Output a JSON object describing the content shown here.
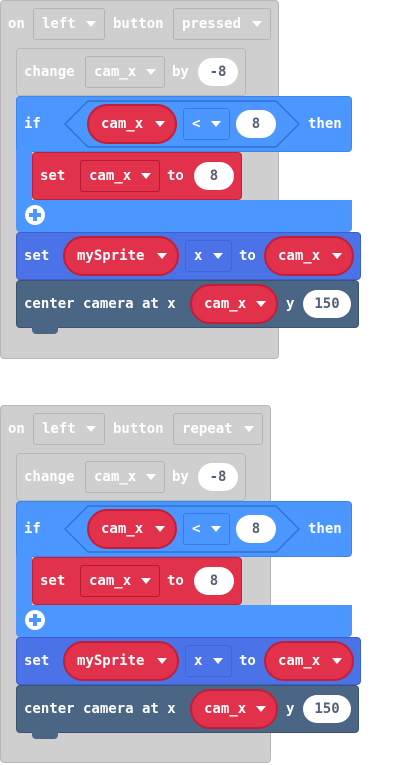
{
  "scripts": [
    {
      "hat": {
        "on": "on",
        "button_key": "left",
        "button": "button",
        "event": "pressed"
      },
      "change": {
        "label": "change",
        "variable": "cam_x",
        "by": "by",
        "amount": "-8"
      },
      "if_block": {
        "if": "if",
        "left": "cam_x",
        "operator": "<",
        "right": "8",
        "then": "then"
      },
      "set_inner": {
        "label": "set",
        "variable": "cam_x",
        "to": "to",
        "value": "8"
      },
      "set_sprite": {
        "label": "set",
        "sprite": "mySprite",
        "property": "x",
        "to": "to",
        "value": "cam_x"
      },
      "camera": {
        "label": "center camera at x",
        "x_value": "cam_x",
        "y": "y",
        "y_value": "150"
      }
    },
    {
      "hat": {
        "on": "on",
        "button_key": "left",
        "button": "button",
        "event": "repeat"
      },
      "change": {
        "label": "change",
        "variable": "cam_x",
        "by": "by",
        "amount": "-8"
      },
      "if_block": {
        "if": "if",
        "left": "cam_x",
        "operator": "<",
        "right": "8",
        "then": "then"
      },
      "set_inner": {
        "label": "set",
        "variable": "cam_x",
        "to": "to",
        "value": "8"
      },
      "set_sprite": {
        "label": "set",
        "sprite": "mySprite",
        "property": "x",
        "to": "to",
        "value": "cam_x"
      },
      "camera": {
        "label": "center camera at x",
        "x_value": "cam_x",
        "y": "y",
        "y_value": "150"
      }
    }
  ],
  "colors": {
    "hat_gray": "#cfcfcf",
    "logic_blue": "#4c97ff",
    "variable_red": "#e2314b",
    "sprite_blue": "#4b72e6",
    "scene_slate": "#4b6584"
  }
}
